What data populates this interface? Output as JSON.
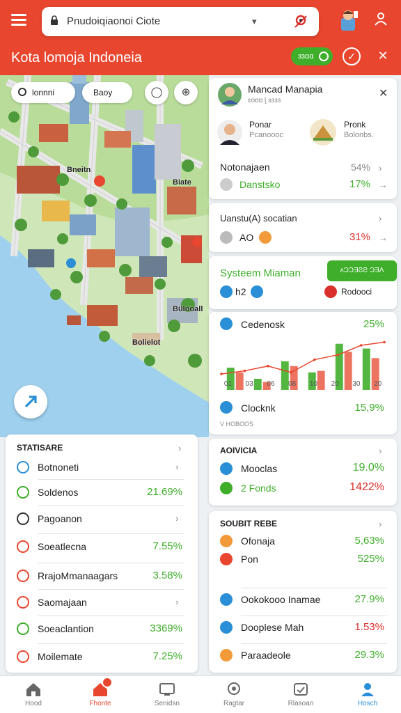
{
  "header": {
    "search_text": "Pnudoiqiaonoi Ciote",
    "subtitle": "Kota lomoja Indoneia",
    "pill_label": "ɜɜɑɑ"
  },
  "map": {
    "chip_1": "lonnni",
    "chip_2": "Baoy",
    "labels": [
      "Bneitn",
      "Biate",
      "Bülooall",
      "Bolielot"
    ]
  },
  "profile_card": {
    "title": "Mancad Manapia",
    "subtitle": "ɛoɒɒ ɭ ɜɜɜɜ",
    "person_1": {
      "name": "Ponar",
      "sub": "Pcanoooc"
    },
    "person_2": {
      "name": "Pronk",
      "sub": "Bolonbs."
    },
    "row_1": {
      "label": "Notonajaen",
      "value": "54%"
    },
    "row_2": {
      "label": "Danstsko",
      "value": "17%"
    }
  },
  "status_card": {
    "title": "Uanstu(A) socatian",
    "row_label": "AO",
    "value": "31%"
  },
  "system_card": {
    "title": "Systeem Miaman",
    "button_label": "ᴧƆƆƎƧƧ ϽƎɅ",
    "tag_1": "h2",
    "tag_2": "Rodooci"
  },
  "chart_card": {
    "row_1": {
      "label": "Cedenosk",
      "value": "25%"
    },
    "row_2": {
      "label": "Clocknk",
      "value": "15,9%"
    },
    "footnote": "V HOBOOS"
  },
  "chart_data": {
    "type": "bar",
    "categories": [
      "01",
      "03",
      "06",
      "08",
      "10",
      "20"
    ],
    "tick_labels": [
      "01",
      "03",
      "06",
      "08",
      "10",
      "20",
      "30",
      "20"
    ],
    "series": [
      {
        "color": "#3fae2b",
        "values": [
          28,
          14,
          36,
          22,
          58,
          52
        ]
      },
      {
        "color": "#e8462e",
        "values": [
          22,
          10,
          30,
          24,
          48,
          40
        ]
      }
    ],
    "line_color": "#e8462e",
    "line_values": [
      20,
      24,
      30,
      22,
      38,
      44,
      56,
      60
    ],
    "ylim": [
      0,
      70
    ]
  },
  "advisor_card": {
    "title": "AOIVICIA",
    "row_1": {
      "label": "Mooclas",
      "value": "19.0%"
    },
    "row_2": {
      "label": "2 Fonds",
      "value": "1422%"
    }
  },
  "summary_card": {
    "title": "SOUBIT REBE",
    "rows": [
      {
        "label": "Ofonaja",
        "value": "5,63%",
        "tone": "green"
      },
      {
        "label": "Pon",
        "value": "525%",
        "tone": "green"
      },
      {
        "label": "Ookokooo Inamae",
        "value": "27.9%",
        "tone": "green"
      },
      {
        "label": "Dooplese Mah",
        "value": "1.53%",
        "tone": "red"
      },
      {
        "label": "Paraadeole",
        "value": "29.3%",
        "tone": "green"
      }
    ]
  },
  "stats_card": {
    "title": "STATISARE",
    "rows": [
      {
        "label": "Botnoneti",
        "value": ""
      },
      {
        "label": "Soldenos",
        "value": "21.69%"
      },
      {
        "label": "Pagoanon",
        "value": ""
      },
      {
        "label": "Soeatlecna",
        "value": "7.55%"
      },
      {
        "label": "RrajoMmanaagars",
        "value": "3.58%"
      },
      {
        "label": "Saomajaan",
        "value": ""
      },
      {
        "label": "Soeaclantion",
        "value": "3369%"
      },
      {
        "label": "Moilemate",
        "value": "7.25%"
      }
    ]
  },
  "bottom_nav": [
    {
      "label": "Hood"
    },
    {
      "label": "Fhonte"
    },
    {
      "label": "Senidsn"
    },
    {
      "label": "Ragtar"
    },
    {
      "label": "Rlasoan"
    },
    {
      "label": "Hosch"
    }
  ],
  "colors": {
    "brand": "#e8462e",
    "accent": "#3fae2b",
    "active": "#2a8fd6"
  }
}
